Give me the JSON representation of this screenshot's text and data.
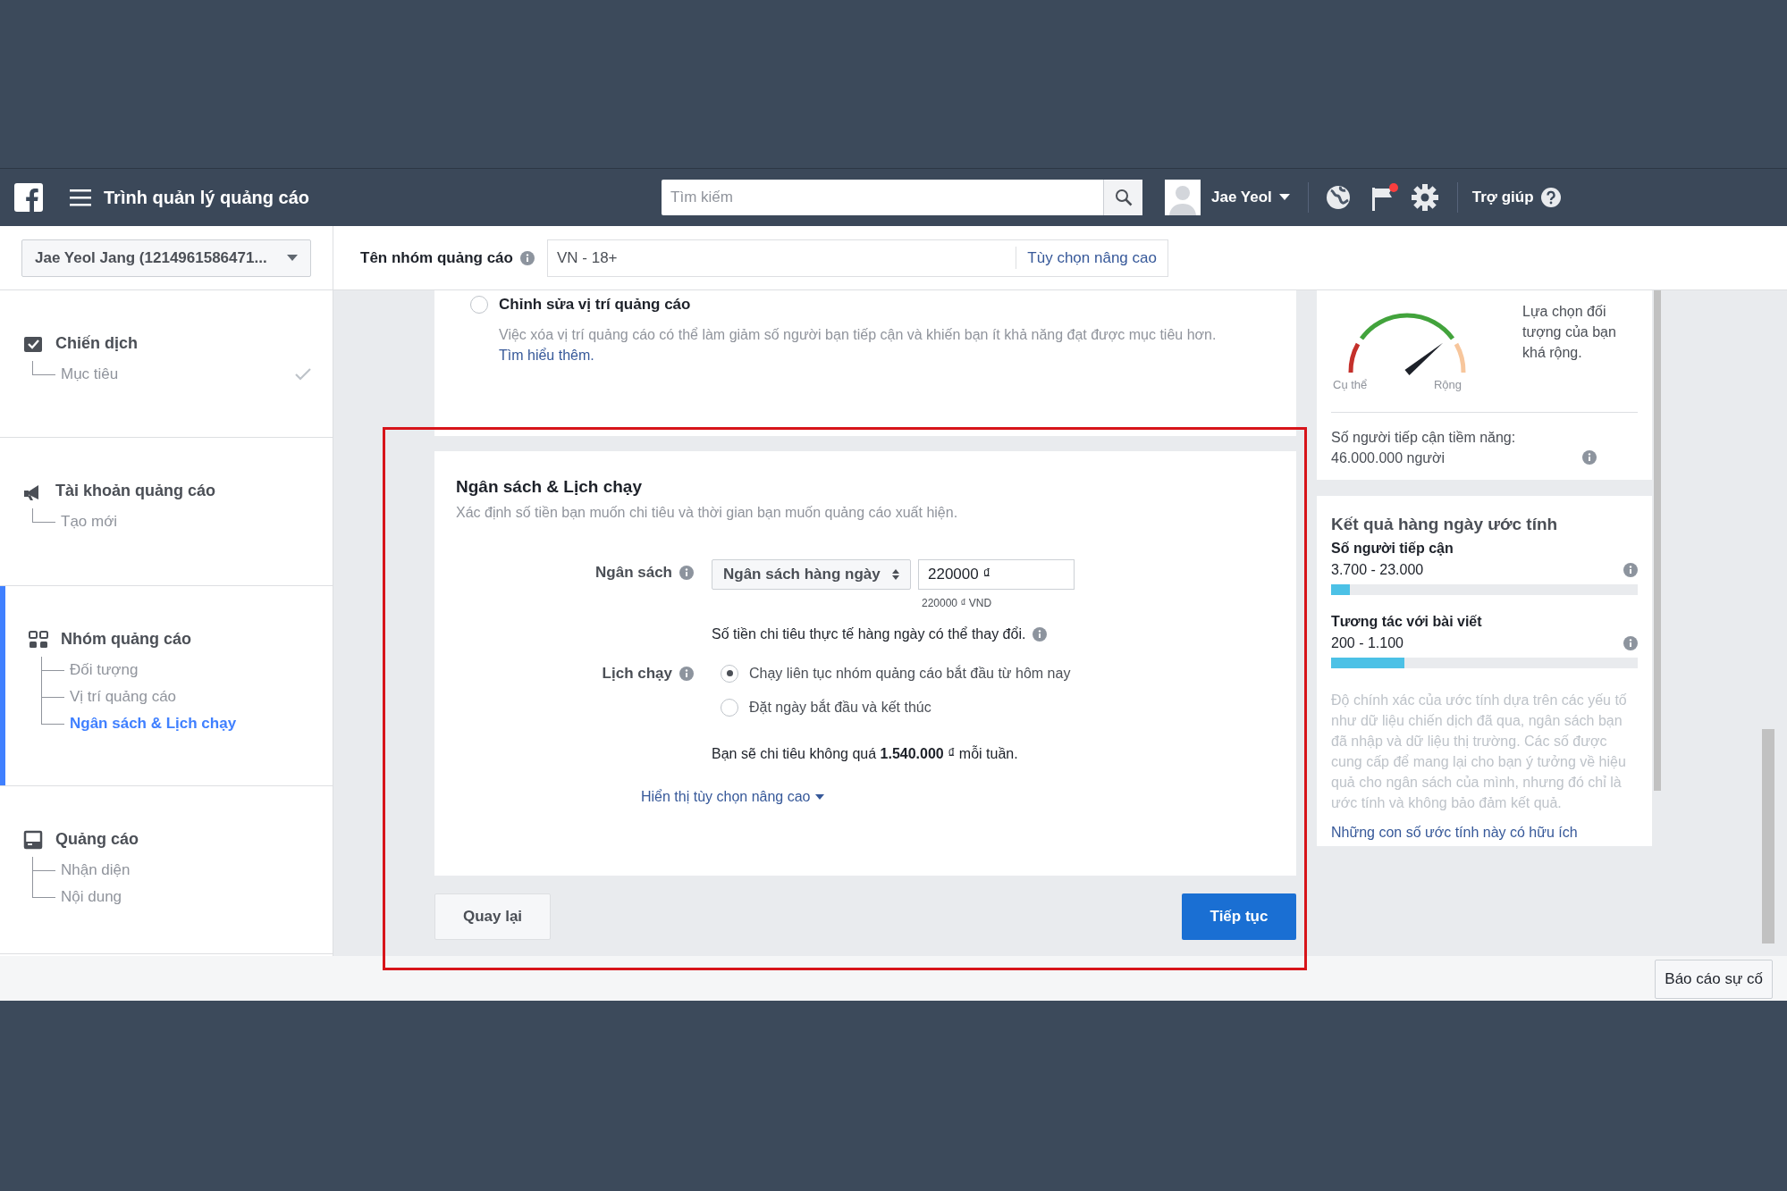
{
  "navbar": {
    "title": "Trình quản lý quảng cáo",
    "search": {
      "placeholder": "Tìm kiếm"
    },
    "user": "Jae Yeol",
    "notification": true,
    "help": "Trợ giúp"
  },
  "ad_set_bar": {
    "account": "Jae Yeol Jang (1214961586471...",
    "label": "Tên nhóm quảng cáo",
    "value": "VN - 18+",
    "advanced_link": "Tùy chọn nâng cao"
  },
  "sidebar": {
    "sections": [
      {
        "kind": "campaign",
        "title": "Chiến dịch",
        "selected": false,
        "children": [
          {
            "label": "Mục tiêu",
            "done": true,
            "selected": false
          }
        ]
      },
      {
        "kind": "account",
        "title": "Tài khoản quảng cáo",
        "selected": false,
        "children": [
          {
            "label": "Tạo mới",
            "done": false,
            "selected": false
          }
        ]
      },
      {
        "kind": "adset",
        "title": "Nhóm quảng cáo",
        "selected": true,
        "children": [
          {
            "label": "Đối tượng",
            "done": false,
            "selected": false
          },
          {
            "label": "Vị trí quảng cáo",
            "done": false,
            "selected": false
          },
          {
            "label": "Ngân sách & Lịch chạy",
            "done": false,
            "selected": true
          }
        ]
      },
      {
        "kind": "ad",
        "title": "Quảng cáo",
        "selected": false,
        "children": [
          {
            "label": "Nhận diện",
            "done": false,
            "selected": false
          },
          {
            "label": "Nội dung",
            "done": false,
            "selected": false
          }
        ]
      }
    ]
  },
  "placement": {
    "option": "Chỉnh sửa vị trí quảng cáo",
    "selected": false,
    "note": "Việc xóa vị trí quảng cáo có thể làm giảm số người bạn tiếp cận và khiến bạn ít khả năng đạt được mục tiêu hơn.",
    "link": "Tìm hiểu thêm."
  },
  "budget": {
    "title": "Ngân sách & Lịch chạy",
    "subtitle": "Xác định số tiền bạn muốn chi tiêu và thời gian bạn muốn quảng cáo xuất hiện.",
    "budget_label": "Ngân sách",
    "budget_type": "Ngân sách hàng ngày",
    "amount": "220000 ₫",
    "amount_hint": "220000 ₫ VND",
    "note": "Số tiền chi tiêu thực tế hàng ngày có thể thay đổi.",
    "schedule_label": "Lịch chạy",
    "schedule_options": [
      {
        "label": "Chạy liên tục nhóm quảng cáo bắt đầu từ hôm nay",
        "selected": true
      },
      {
        "label": "Đặt ngày bắt đầu và kết thúc",
        "selected": false
      }
    ],
    "weekly": "Bạn sẽ chi tiêu không quá **1.540.000** ₫ mỗi tuần.",
    "advanced_toggle": "Hiển thị tùy chọn nâng cao"
  },
  "buttons": {
    "back": "Quay lại",
    "next": "Tiếp tục"
  },
  "audience": {
    "gauge": {
      "left_label": "Cụ thể",
      "right_label": "Rộng"
    },
    "description": "Lựa chọn đối tượng của bạn khá rộng.",
    "potential": "Số người tiếp cận tiềm năng: 46.000.000 người"
  },
  "estimates": {
    "title": "Kết quả hàng ngày ước tính",
    "metrics": [
      {
        "label": "Số người tiếp cận",
        "range": "3.700 - 23.000",
        "level": 0.06
      },
      {
        "label": "Tương tác với bài viết",
        "range": "200 - 1.100",
        "level": 0.24
      }
    ],
    "disclaimer": "Độ chính xác của ước tính dựa trên các yếu tố như dữ liệu chiến dịch đã qua, ngân sách bạn đã nhập và dữ liệu thị trường. Các số được cung cấp để mang lại cho bạn ý tưởng về hiệu quả cho ngân sách của mình, nhưng đó chỉ là ước tính và không bảo đảm kết quả.",
    "link": "Những con số ước tính này có hữu ích"
  },
  "footer": {
    "report_button": "Báo cáo sự cố"
  }
}
